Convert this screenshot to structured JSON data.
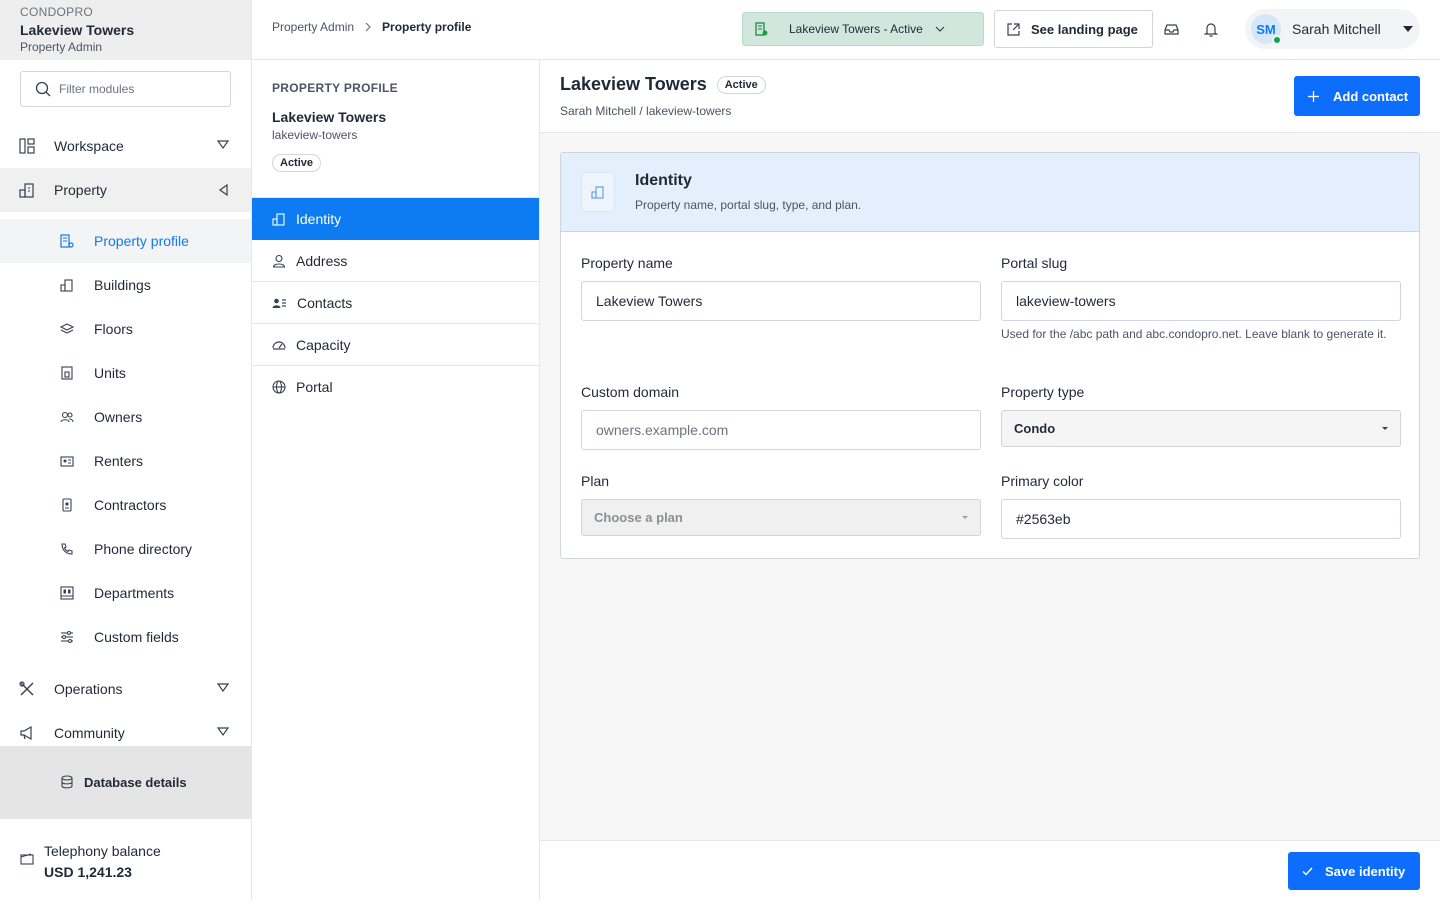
{
  "brand": {
    "app": "CONDOPRO",
    "property": "Lakeview Towers",
    "role": "Property Admin"
  },
  "sidebar": {
    "filter_placeholder": "Filter modules",
    "groups": {
      "workspace": "Workspace",
      "property": "Property",
      "operations": "Operations",
      "community": "Community"
    },
    "property_items": [
      {
        "label": "Property profile",
        "icon": "building-cog-icon"
      },
      {
        "label": "Buildings",
        "icon": "buildings-icon"
      },
      {
        "label": "Floors",
        "icon": "layers-icon"
      },
      {
        "label": "Units",
        "icon": "door-icon"
      },
      {
        "label": "Owners",
        "icon": "users-icon"
      },
      {
        "label": "Renters",
        "icon": "id-card-icon"
      },
      {
        "label": "Contractors",
        "icon": "badge-icon"
      },
      {
        "label": "Phone directory",
        "icon": "phone-icon"
      },
      {
        "label": "Departments",
        "icon": "departments-icon"
      },
      {
        "label": "Custom fields",
        "icon": "sliders-icon"
      }
    ],
    "database_details": "Database details",
    "balance_label": "Telephony balance",
    "balance_value": "USD 1,241.23"
  },
  "topbar": {
    "breadcrumb": [
      "Property Admin",
      "Property profile"
    ],
    "property_switcher": "Lakeview Towers - Active",
    "landing_button": "See landing page",
    "user_initials": "SM",
    "user_name": "Sarah Mitchell"
  },
  "subnav": {
    "section": "PROPERTY PROFILE",
    "property_name": "Lakeview Towers",
    "property_slug": "lakeview-towers",
    "status": "Active",
    "items": [
      "Identity",
      "Address",
      "Contacts",
      "Capacity",
      "Portal"
    ]
  },
  "main": {
    "title": "Lakeview Towers",
    "status": "Active",
    "path": "Sarah Mitchell / lakeview-towers",
    "add_contact": "Add contact",
    "card": {
      "title": "Identity",
      "description": "Property name, portal slug, type, and plan."
    },
    "fields": {
      "property_name_label": "Property name",
      "property_name_value": "Lakeview Towers",
      "portal_slug_label": "Portal slug",
      "portal_slug_value": "lakeview-towers",
      "portal_slug_help": "Used for the /abc path and abc.condopro.net. Leave blank to generate it.",
      "custom_domain_label": "Custom domain",
      "custom_domain_placeholder": "owners.example.com",
      "property_type_label": "Property type",
      "property_type_value": "Condo",
      "plan_label": "Plan",
      "plan_value": "Choose a plan",
      "primary_color_label": "Primary color",
      "primary_color_value": "#2563eb"
    },
    "save_button": "Save identity"
  },
  "colors": {
    "accent": "#0d7bf2",
    "primary_button": "#0d6efd",
    "status_green": "#16a34a",
    "switcher_bg": "#d1e7dd",
    "card_header_bg": "#e3effc"
  }
}
